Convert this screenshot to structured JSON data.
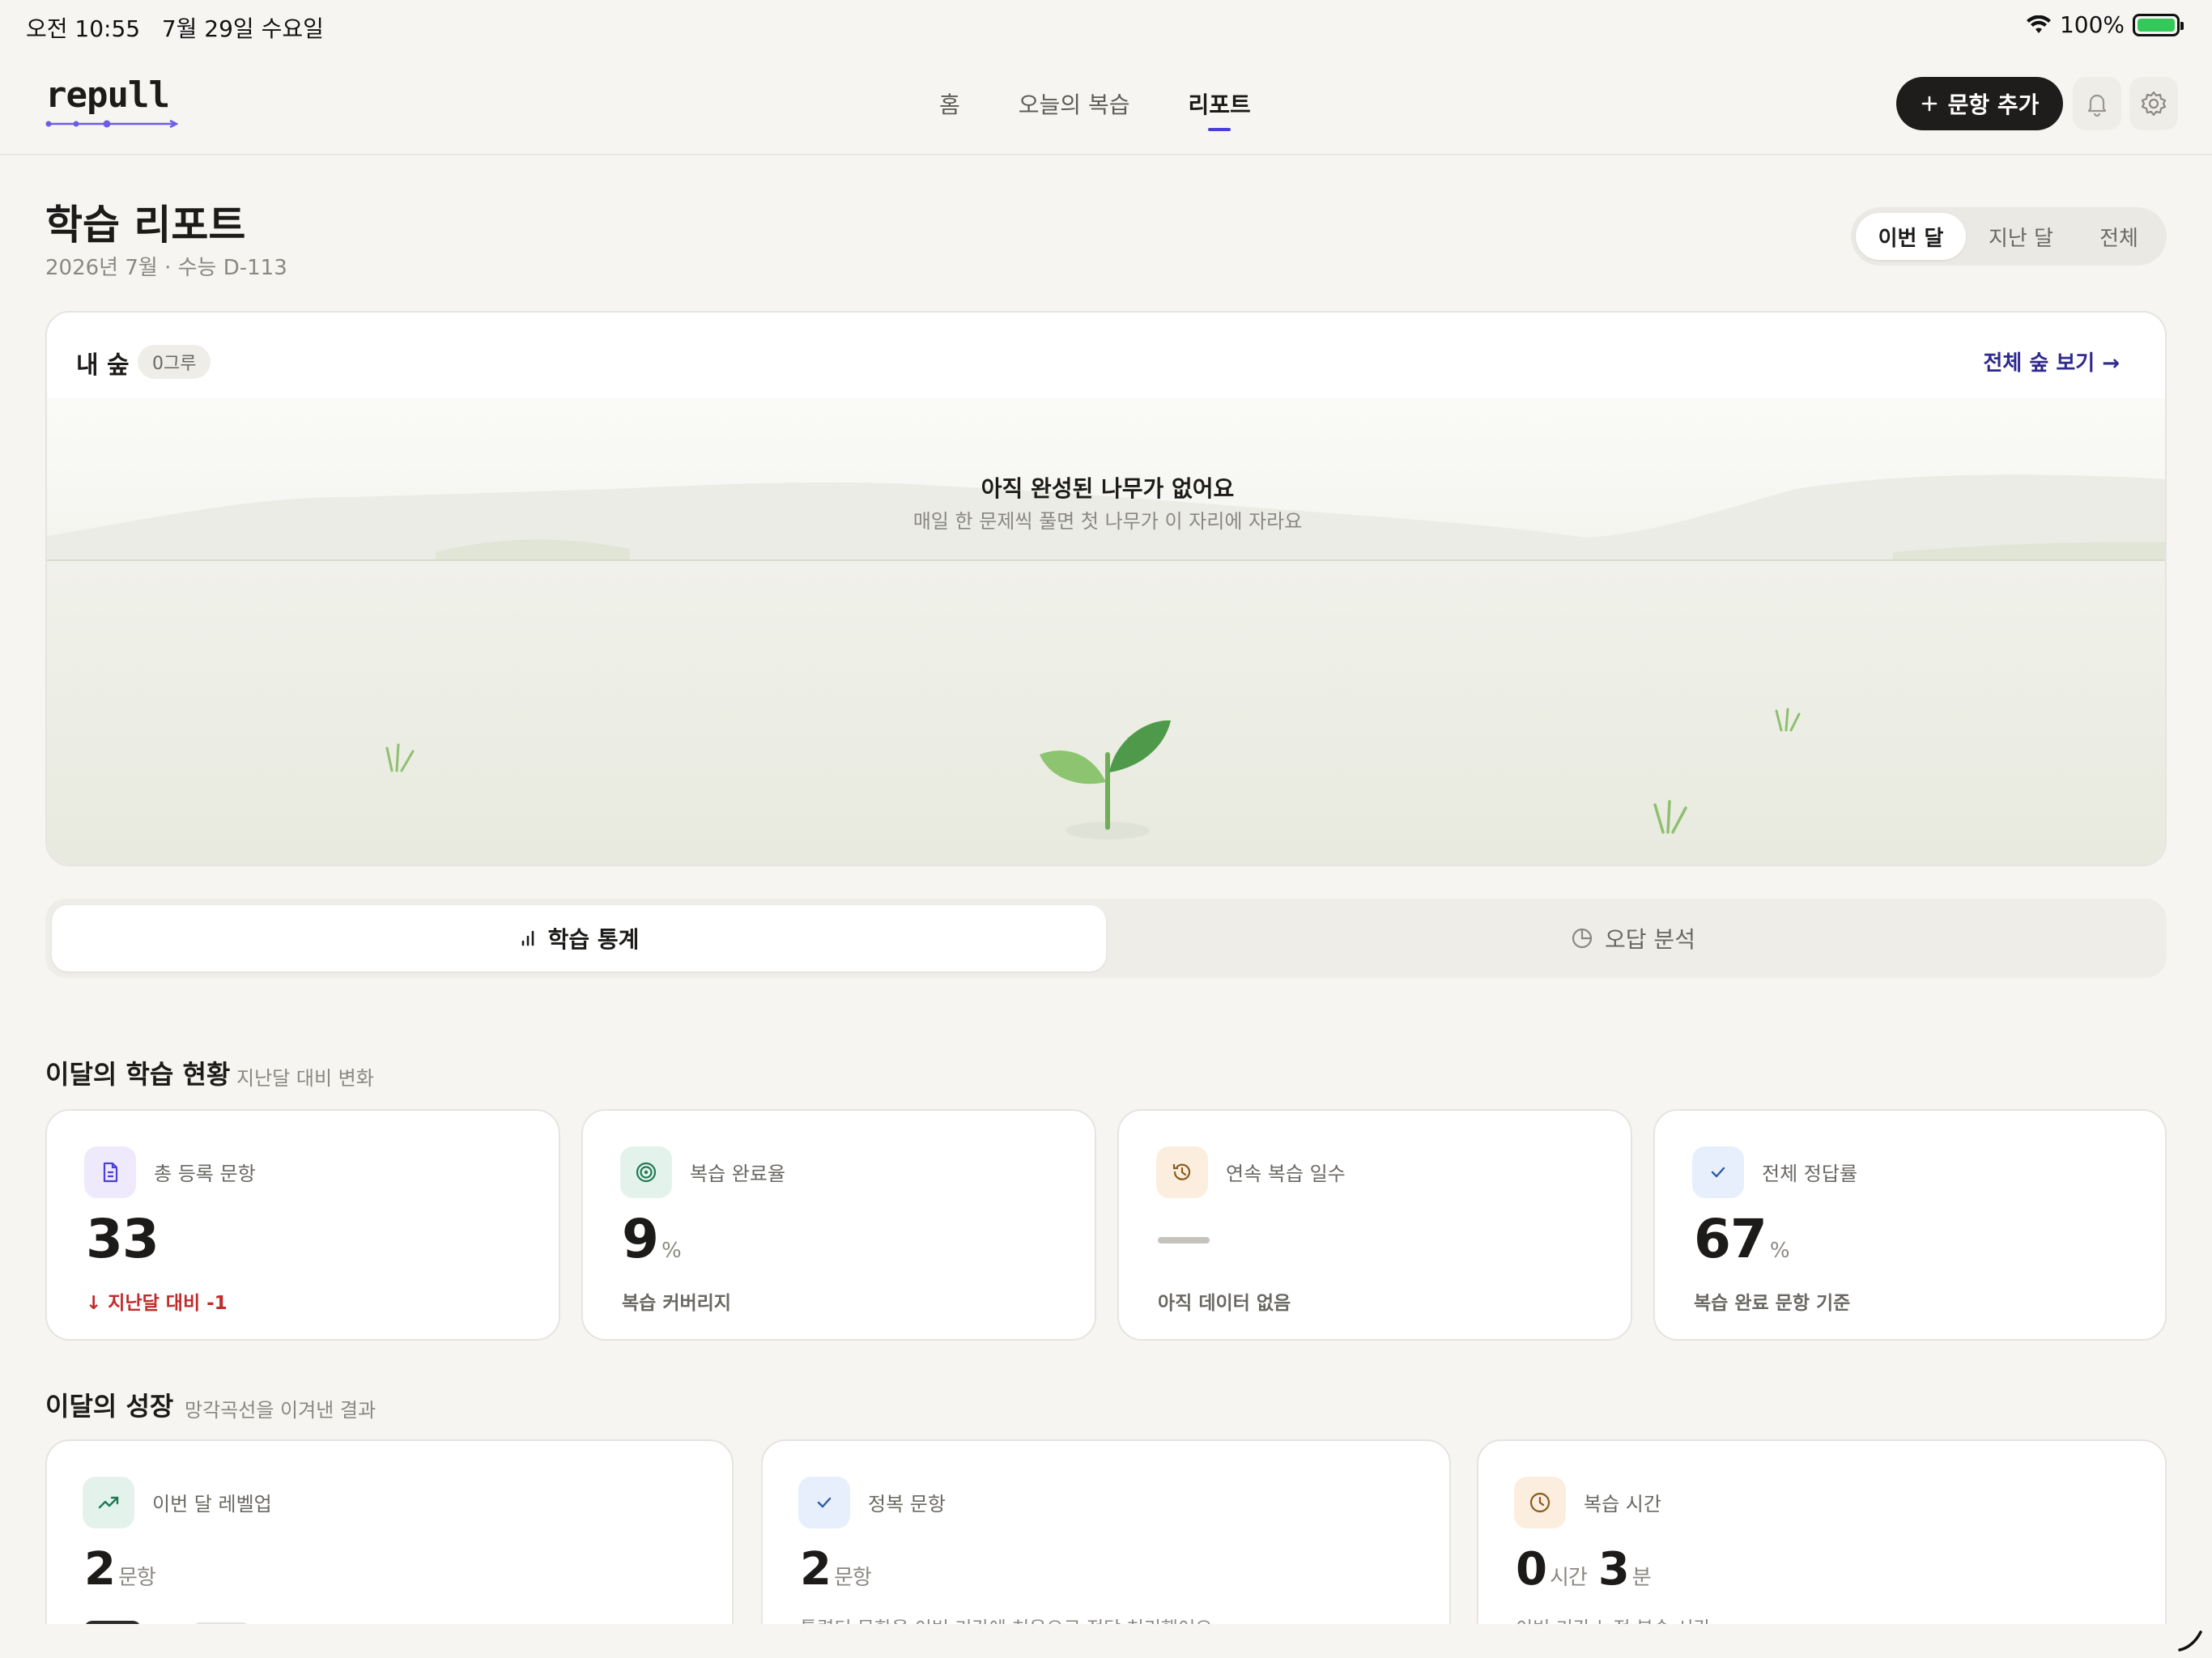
{
  "status_bar": {
    "time": "오전 10:55",
    "date": "7월 29일 수요일",
    "battery": "100%"
  },
  "nav": {
    "logo": "repull",
    "tabs": [
      {
        "label": "홈",
        "active": false
      },
      {
        "label": "오늘의 복습",
        "active": false
      },
      {
        "label": "리포트",
        "active": true
      }
    ],
    "add_button": "문항 추가",
    "accent": "#4b3fd8"
  },
  "header": {
    "title": "학습 리포트",
    "subtitle": "2026년 7월 · 수능 D-113",
    "period_options": [
      "이번 달",
      "지난 달",
      "전체"
    ],
    "period_selected": "이번 달"
  },
  "forest": {
    "title": "내 숲",
    "count_badge": "0그루",
    "view_all": "전체 숲 보기 →",
    "empty_title": "아직 완성된 나무가 없어요",
    "empty_subtitle": "매일 한 문제씩 풀면 첫 나무가 이 자리에 자라요"
  },
  "tabs": [
    {
      "label": "학습 통계",
      "icon": "bar-chart-icon",
      "active": true
    },
    {
      "label": "오답 분석",
      "icon": "pie-chart-icon",
      "active": false
    }
  ],
  "monthly_status": {
    "title": "이달의 학습 현황",
    "subtitle": "지난달 대비 변화",
    "cards": [
      {
        "label": "총 등록 문항",
        "value": "33",
        "unit": "",
        "foot": "지난달 대비 -1",
        "icon": "document-icon",
        "icon_bg": "#eeeafb",
        "icon_color": "#4b3fd8"
      },
      {
        "label": "복습 완료율",
        "value": "9",
        "unit": "%",
        "foot": "복습 커버리지",
        "icon": "target-icon",
        "icon_bg": "#e3f3ec",
        "icon_color": "#1f7a56"
      },
      {
        "label": "연속 복습 일수",
        "value": "",
        "unit": "",
        "foot": "아직 데이터 없음",
        "icon": "history-icon",
        "icon_bg": "#fbeede",
        "icon_color": "#8a5a1c"
      },
      {
        "label": "전체 정답률",
        "value": "67",
        "unit": "%",
        "foot": "복습 완료 문항 기준",
        "icon": "check-icon",
        "icon_bg": "#e6effb",
        "icon_color": "#2d5aa6"
      }
    ]
  },
  "growth": {
    "title": "이달의 성장",
    "subtitle": "망각곡선을 이겨낸 결과",
    "cards": [
      {
        "label": "이번 달 레벨업",
        "value": "2",
        "unit": "문항",
        "foot": "",
        "icon": "trending-up-icon",
        "icon_bg": "#e3f3ec",
        "icon_color": "#1f7a56"
      },
      {
        "label": "정복 문항",
        "value": "2",
        "unit": "문항",
        "foot": "틀렸던 문항을 이번 기간에 처음으로 정답 처리했어요",
        "icon": "check-icon",
        "icon_bg": "#e6effb",
        "icon_color": "#2d5aa6"
      },
      {
        "label": "복습 시간",
        "value_h": "0",
        "unit_h": "시간",
        "value_m": "3",
        "unit_m": "분",
        "foot": "이번 기간 누적 복습 시간",
        "icon": "clock-icon",
        "icon_bg": "#fbeede",
        "icon_color": "#8a5a1c"
      }
    ]
  }
}
